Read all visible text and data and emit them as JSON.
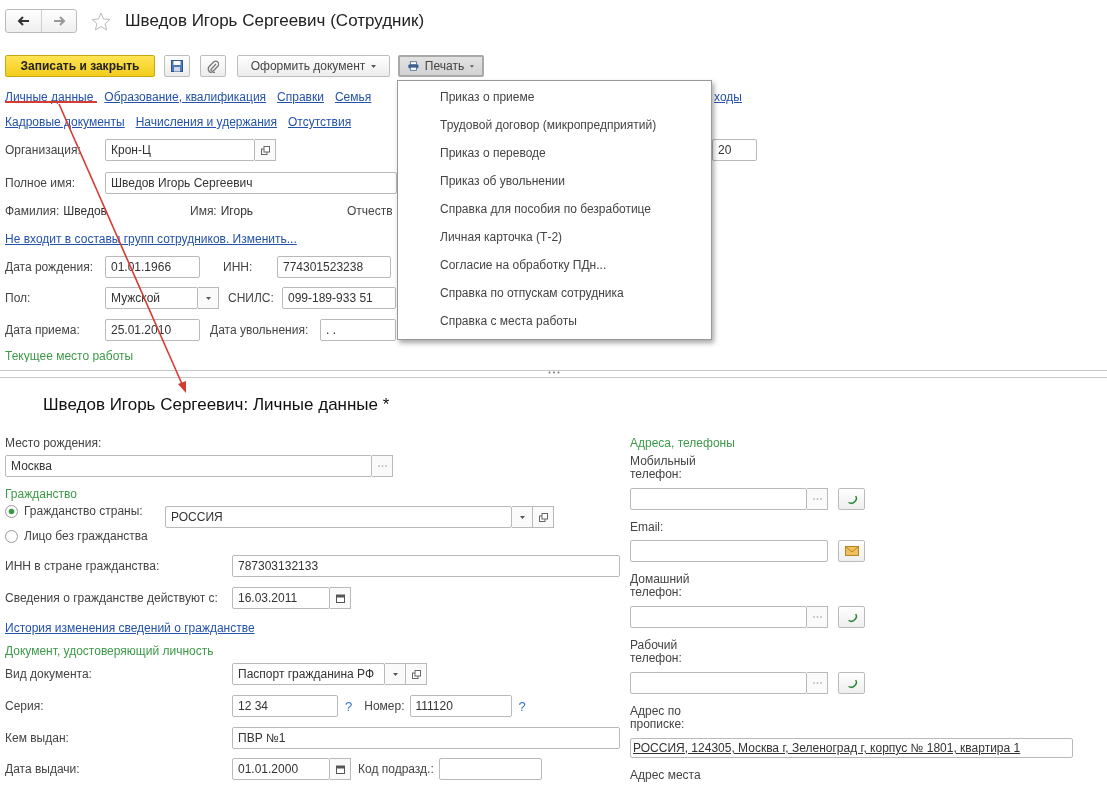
{
  "window": {
    "title": "Шведов Игорь Сергеевич (Сотрудник)"
  },
  "toolbar": {
    "save_close": "Записать и закрыть",
    "create_document": "Оформить документ",
    "print": "Печать"
  },
  "print_menu": [
    "Приказ о приеме",
    "Трудовой договор (микропредприятий)",
    "Приказ о переводе",
    "Приказ об увольнении",
    "Справка для пособия по безработице",
    "Личная карточка (Т-2)",
    "Согласие на обработку ПДн...",
    "Справка по отпускам сотрудника",
    "Справка с места работы"
  ],
  "section_links": {
    "row_1": [
      "Личные данные",
      "Образование, квалификация",
      "Справки",
      "Семья",
      "ходы"
    ],
    "row_2": [
      "Кадровые документы",
      "Начисления и удержания",
      "Отсутствия"
    ]
  },
  "employee": {
    "organization": {
      "label": "Организация:",
      "value": "Крон-Ц"
    },
    "partly_hidden_field": {
      "value": "20"
    },
    "full_name": {
      "label": "Полное имя:",
      "value": "Шведов Игорь Сергеевич"
    },
    "name_parts": [
      {
        "label": "Фамилия:",
        "value": "Шведов"
      },
      {
        "label": "Имя:",
        "value": "Игорь"
      },
      {
        "label": "Отчеств"
      }
    ],
    "groups_link": "Не входит в составы групп сотрудников. Изменить...",
    "birth_date": {
      "label": "Дата рождения:",
      "value": "01.01.1966"
    },
    "inn": {
      "label": "ИНН:",
      "value": "774301523238"
    },
    "gender": {
      "label": "Пол:",
      "value": "Мужской"
    },
    "snils": {
      "label": "СНИЛС:",
      "value": "099-189-933 51"
    },
    "hire_date": {
      "label": "Дата приема:",
      "value": "25.01.2010"
    },
    "dismissal_date": {
      "label": "Дата увольнения:",
      "value": ". ."
    },
    "current_job_group": "Текущее место работы"
  },
  "personal": {
    "title": "Шведов Игорь Сергеевич: Личные данные *",
    "birthplace": {
      "label": "Место рождения:",
      "value": "Москва"
    },
    "citizenship_group": "Гражданство",
    "citizenship_options": [
      {
        "label": "Гражданство страны:",
        "selected": true
      },
      {
        "label": "Лицо без гражданства",
        "selected": false
      }
    ],
    "country": {
      "value": "РОССИЯ"
    },
    "foreign_inn": {
      "label": "ИНН в стране гражданства:",
      "value": "787303132133"
    },
    "citizenship_since": {
      "label": "Сведения о гражданстве действуют с:",
      "value": "16.03.2011"
    },
    "history_link": "История изменения сведений о гражданстве",
    "id_group": "Документ, удостоверяющий личность",
    "doc_type": {
      "label": "Вид документа:",
      "value": "Паспорт гражданина РФ"
    },
    "series": {
      "label": "Серия:",
      "value": "12 34",
      "help": "?"
    },
    "number": {
      "label": "Номер:",
      "value": "111120",
      "help": "?"
    },
    "issued_by": {
      "label": "Кем выдан:",
      "value": "ПВР №1"
    },
    "issue_date": {
      "label": "Дата выдачи:",
      "value": "01.01.2000"
    },
    "dept_code": {
      "label": "Код подразд.:"
    },
    "contacts_group": "Адреса, телефоны",
    "contacts": [
      {
        "kind": "phone",
        "label": "Мобильный телефон:"
      },
      {
        "kind": "email",
        "label": "Email:"
      },
      {
        "kind": "phone",
        "label": "Домашний телефон:"
      },
      {
        "kind": "phone",
        "label": "Рабочий телефон:"
      },
      {
        "kind": "address",
        "label": "Адрес по прописке:",
        "value": "РОССИЯ, 124305, Москва г, Зеленоград г, корпус № 1801, квартира 1"
      },
      {
        "kind": "cut",
        "label": "Адрес места"
      }
    ]
  }
}
